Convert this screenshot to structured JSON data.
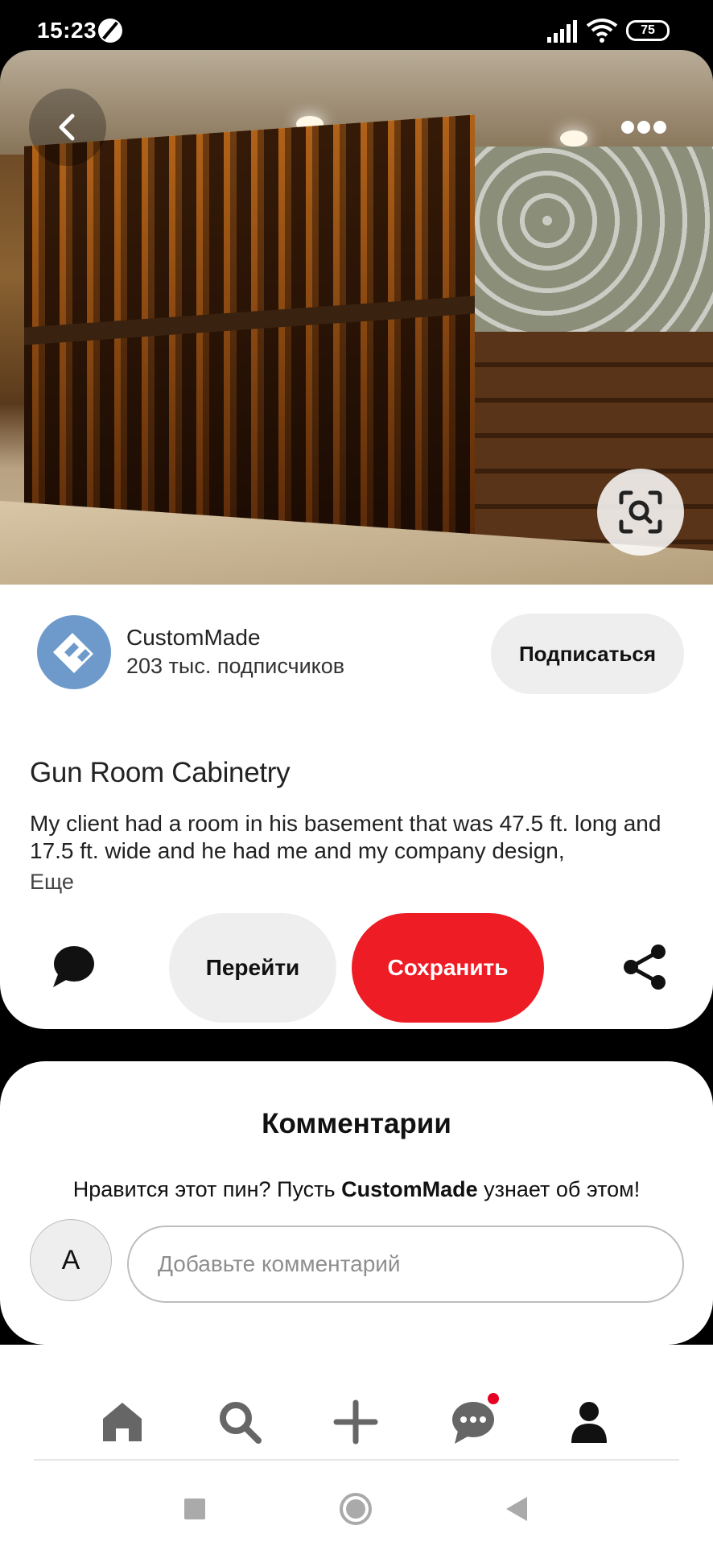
{
  "status_bar": {
    "time": "15:23",
    "battery": "75"
  },
  "pin": {
    "author": {
      "name": "CustomMade",
      "followers": "203 тыс. подписчиков"
    },
    "subscribe_label": "Подписаться",
    "title": "Gun Room Cabinetry",
    "description": "My client had a room in his basement that was 47.5 ft. long and 17.5 ft. wide and he had me and my company design,",
    "more_label": "Еще",
    "go_label": "Перейти",
    "save_label": "Сохранить"
  },
  "comments": {
    "title": "Комментарии",
    "prompt_before": "Нравится этот пин? Пусть ",
    "prompt_author": "CustomMade",
    "prompt_after": " узнает об этом!",
    "user_initial": "A",
    "input_placeholder": "Добавьте комментарий"
  },
  "colors": {
    "save": "#ee1c25",
    "secondary_btn": "#efeeef",
    "logo": "#6e9acb",
    "notification_dot": "#e60023"
  },
  "nav": {
    "items": [
      {
        "name": "home",
        "icon": "home-icon"
      },
      {
        "name": "search",
        "icon": "search-icon"
      },
      {
        "name": "create",
        "icon": "plus-icon"
      },
      {
        "name": "messages",
        "icon": "chat-icon",
        "has_notification": true
      },
      {
        "name": "profile",
        "icon": "profile-icon"
      }
    ]
  }
}
